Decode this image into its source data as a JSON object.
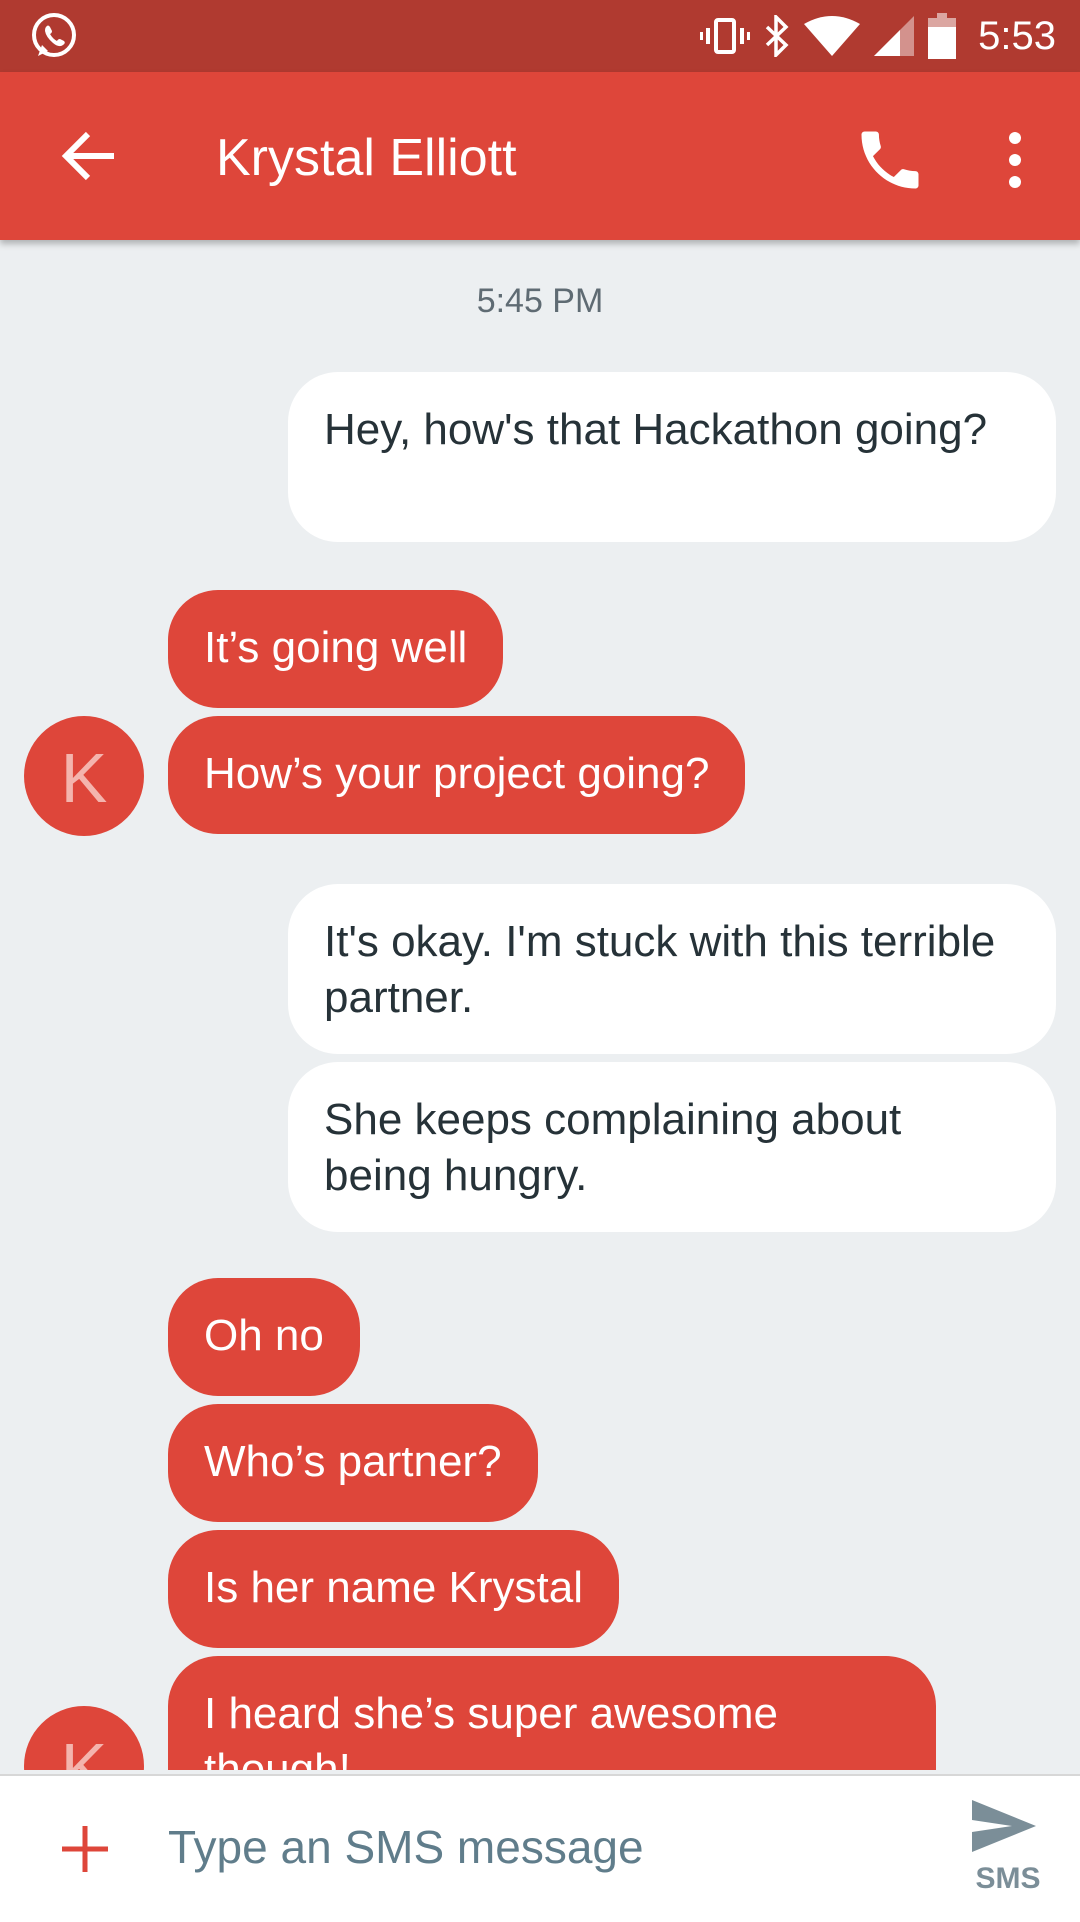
{
  "status_bar": {
    "time": "5:53"
  },
  "header": {
    "contact_name": "Krystal Elliott"
  },
  "conversation": {
    "timestamp": "5:45 PM",
    "avatar_letter": "K",
    "messages": [
      {
        "direction": "out",
        "text": "Hey, how's that Hackathon going?"
      },
      {
        "direction": "in",
        "text": "It’s going well"
      },
      {
        "direction": "in",
        "text": "How’s your project going?"
      },
      {
        "direction": "out",
        "text": "It's okay. I'm stuck with this terrible partner."
      },
      {
        "direction": "out",
        "text": "She keeps complaining about being hungry."
      },
      {
        "direction": "in",
        "text": "Oh no"
      },
      {
        "direction": "in",
        "text": "Who’s partner?"
      },
      {
        "direction": "in",
        "text": "Is her name Krystal"
      },
      {
        "direction": "in",
        "text": "I heard she’s super awesome though!"
      }
    ]
  },
  "composer": {
    "placeholder": "Type an SMS message",
    "send_label": "SMS"
  },
  "colors": {
    "accent": "#de463a",
    "status_bar": "#b03a30",
    "background": "#eceff1"
  }
}
